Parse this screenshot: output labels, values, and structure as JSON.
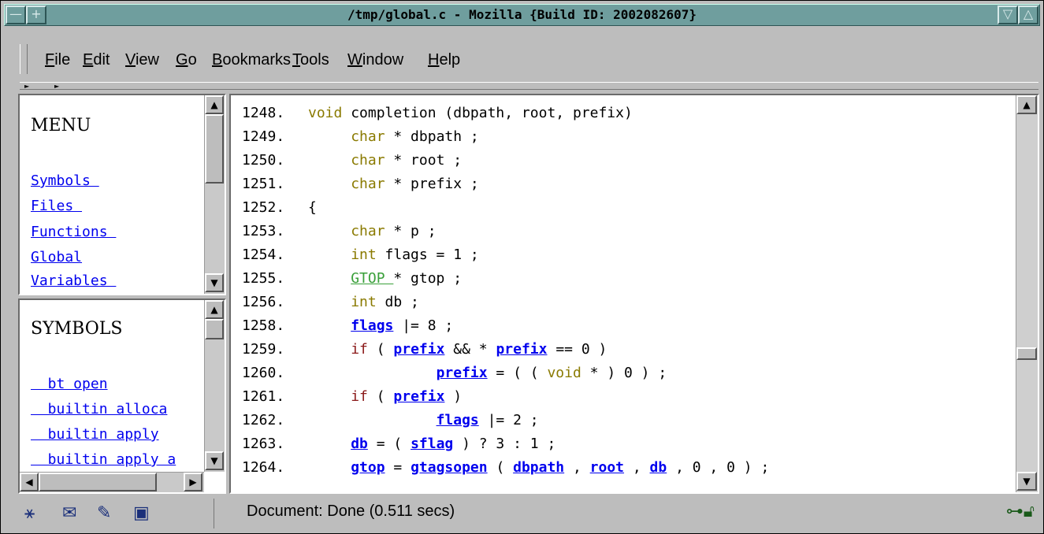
{
  "window": {
    "title": "/tmp/global.c - Mozilla {Build ID: 2002082607}",
    "minimize_icon": "triangle-down",
    "maximize_icon": "triangle-up"
  },
  "menubar": {
    "items": [
      {
        "key": "F",
        "rest": "ile"
      },
      {
        "key": "E",
        "rest": "dit"
      },
      {
        "key": "V",
        "rest": "iew"
      },
      {
        "key": "G",
        "rest": "o"
      },
      {
        "key": "B",
        "rest": "ookmarks"
      },
      {
        "key": "T",
        "rest": "ools"
      },
      {
        "key": "W",
        "rest": "indow"
      },
      {
        "key": "H",
        "rest": "elp"
      }
    ]
  },
  "menu_frame": {
    "heading": "MENU",
    "links": [
      "Symbols ",
      "Files ",
      "Functions ",
      "Global",
      "Variables "
    ]
  },
  "symbols_frame": {
    "heading": "SYMBOLS",
    "links": [
      "  bt open",
      "  builtin alloca",
      "  builtin apply",
      "  builtin apply a"
    ]
  },
  "code": {
    "lines": [
      {
        "n": "1248.",
        "parts": [
          {
            "t": "void",
            "c": "kw"
          },
          {
            "t": " completion (dbpath, root, prefix)"
          }
        ]
      },
      {
        "n": "1249.",
        "parts": [
          {
            "t": "     "
          },
          {
            "t": "char",
            "c": "kw"
          },
          {
            "t": " * dbpath ;"
          }
        ]
      },
      {
        "n": "1250.",
        "parts": [
          {
            "t": "     "
          },
          {
            "t": "char",
            "c": "kw"
          },
          {
            "t": " * root ;"
          }
        ]
      },
      {
        "n": "1251.",
        "parts": [
          {
            "t": "     "
          },
          {
            "t": "char",
            "c": "kw"
          },
          {
            "t": " * prefix ;"
          }
        ]
      },
      {
        "n": "1252.",
        "parts": [
          {
            "t": "{"
          }
        ]
      },
      {
        "n": "1253.",
        "parts": [
          {
            "t": "     "
          },
          {
            "t": "char",
            "c": "kw"
          },
          {
            "t": " * p ;"
          }
        ]
      },
      {
        "n": "1254.",
        "parts": [
          {
            "t": "     "
          },
          {
            "t": "int",
            "c": "kw"
          },
          {
            "t": " flags = 1 ;"
          }
        ]
      },
      {
        "n": "1255.",
        "parts": [
          {
            "t": "     "
          },
          {
            "t": "GTOP ",
            "c": "gtop"
          },
          {
            "t": "* gtop ;"
          }
        ]
      },
      {
        "n": "1256.",
        "parts": [
          {
            "t": "     "
          },
          {
            "t": "int",
            "c": "kw"
          },
          {
            "t": " db ;"
          }
        ]
      },
      {
        "n": "1258.",
        "parts": [
          {
            "t": "     "
          },
          {
            "t": "flags",
            "c": "ref"
          },
          {
            "t": " |= 8 ;"
          }
        ]
      },
      {
        "n": "1259.",
        "parts": [
          {
            "t": "     "
          },
          {
            "t": "if",
            "c": "kw2"
          },
          {
            "t": " ( "
          },
          {
            "t": "prefix",
            "c": "ref"
          },
          {
            "t": " && * "
          },
          {
            "t": "prefix",
            "c": "ref"
          },
          {
            "t": " == 0 )"
          }
        ]
      },
      {
        "n": "1260.",
        "parts": [
          {
            "t": "               "
          },
          {
            "t": "prefix",
            "c": "ref"
          },
          {
            "t": " = ( ( "
          },
          {
            "t": "void",
            "c": "kw"
          },
          {
            "t": " * ) 0 ) ;"
          }
        ]
      },
      {
        "n": "1261.",
        "parts": [
          {
            "t": "     "
          },
          {
            "t": "if",
            "c": "kw2"
          },
          {
            "t": " ( "
          },
          {
            "t": "prefix",
            "c": "ref"
          },
          {
            "t": " )"
          }
        ]
      },
      {
        "n": "1262.",
        "parts": [
          {
            "t": "               "
          },
          {
            "t": "flags",
            "c": "ref"
          },
          {
            "t": " |= 2 ;"
          }
        ]
      },
      {
        "n": "1263.",
        "parts": [
          {
            "t": "     "
          },
          {
            "t": "db",
            "c": "ref"
          },
          {
            "t": " = ( "
          },
          {
            "t": "sflag",
            "c": "ref"
          },
          {
            "t": " ) ? 3 : 1 ;"
          }
        ]
      },
      {
        "n": "1264.",
        "parts": [
          {
            "t": "     "
          },
          {
            "t": "gtop",
            "c": "ref"
          },
          {
            "t": " = "
          },
          {
            "t": "gtagsopen",
            "c": "ref"
          },
          {
            "t": " ( "
          },
          {
            "t": "dbpath",
            "c": "ref"
          },
          {
            "t": " , "
          },
          {
            "t": "root",
            "c": "ref"
          },
          {
            "t": " , "
          },
          {
            "t": "db",
            "c": "ref"
          },
          {
            "t": " , 0 , 0 ) ;"
          }
        ]
      }
    ]
  },
  "statusbar": {
    "icons": [
      "navigator-icon",
      "mail-icon",
      "composer-icon",
      "address-book-icon"
    ],
    "text": "Document: Done (0.511 secs)",
    "right_icons": [
      "online-icon",
      "lock-icon"
    ]
  }
}
